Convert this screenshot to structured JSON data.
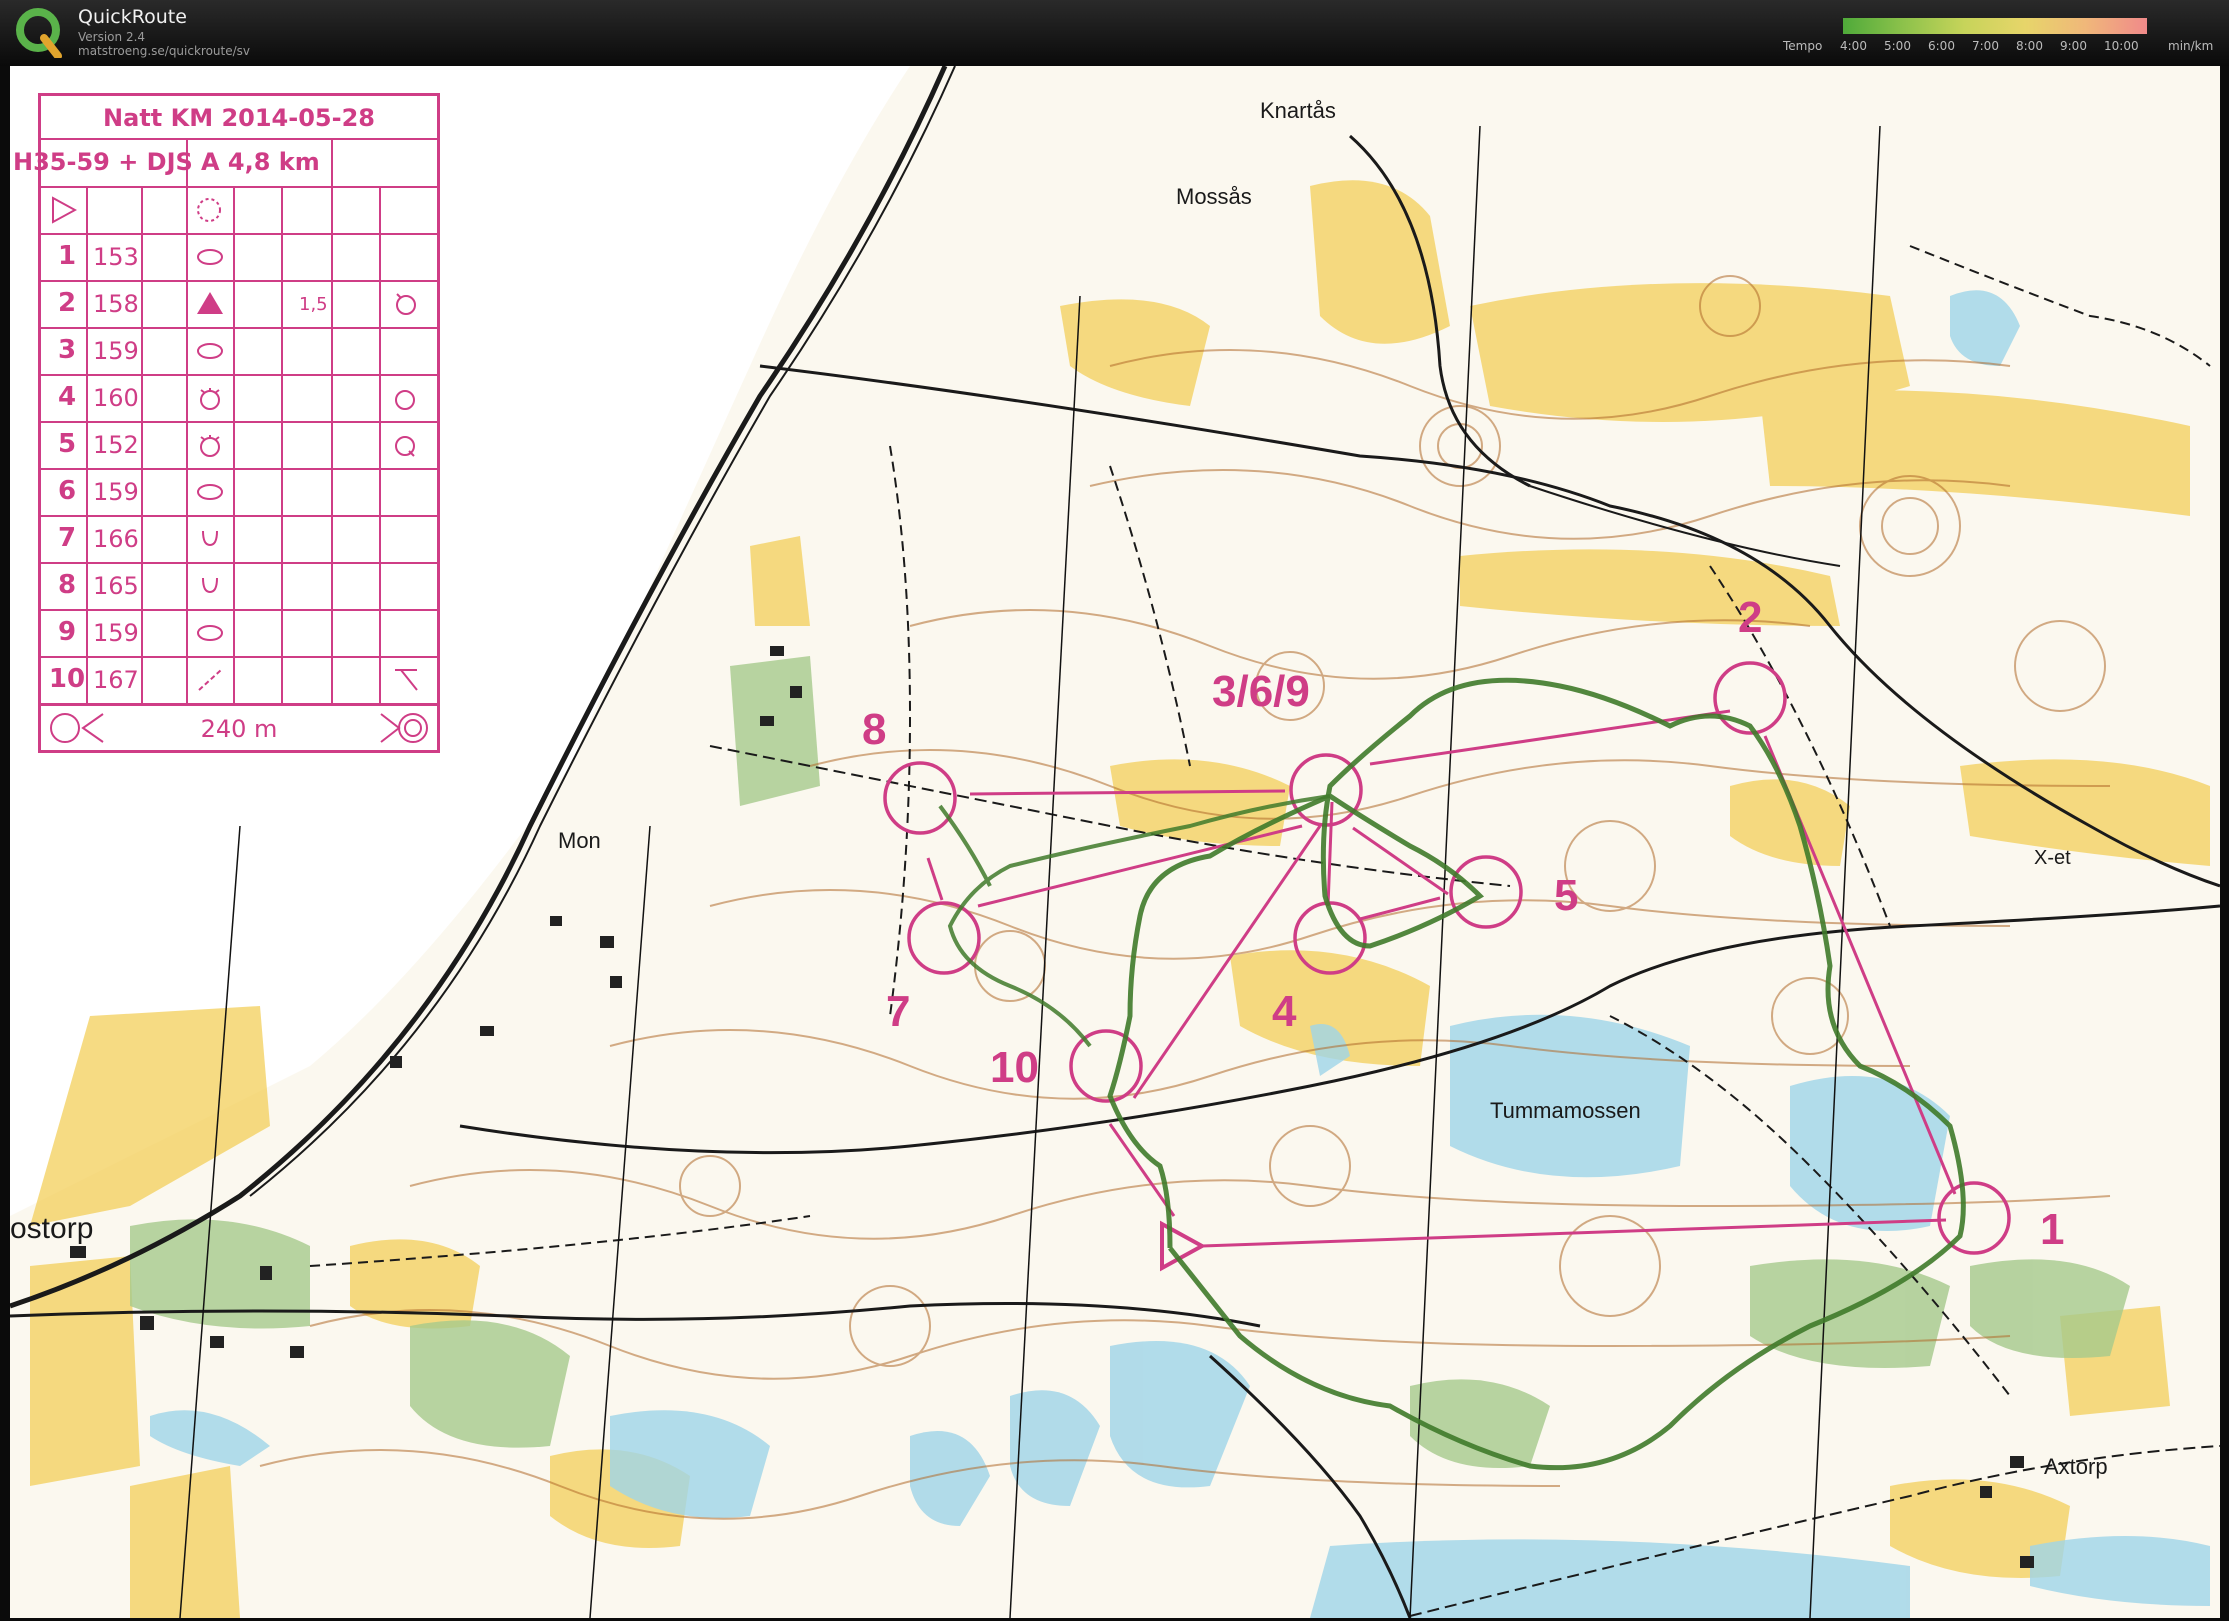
{
  "app": {
    "title": "QuickRoute",
    "version": "Version 2.4",
    "url": "matstroeng.se/quickroute/sv",
    "tempo_label": "Tempo",
    "tempo_ticks": [
      "4:00",
      "5:00",
      "6:00",
      "7:00",
      "8:00",
      "9:00",
      "10:00"
    ],
    "tempo_unit": "min/km"
  },
  "colors": {
    "course": "#cf3d86",
    "route": "#3f7a2a",
    "yellow": "#f3cf5a",
    "water": "#9fd4e8",
    "green": "#a6c98c",
    "contour": "#b06a2a"
  },
  "card": {
    "title": "Natt KM 2014-05-28",
    "class": "H35-59 + DJS",
    "course": "A 4,8 km",
    "controls": [
      {
        "num": "1",
        "code": "153"
      },
      {
        "num": "2",
        "code": "158",
        "dist": "1,5"
      },
      {
        "num": "3",
        "code": "159"
      },
      {
        "num": "4",
        "code": "160"
      },
      {
        "num": "5",
        "code": "152"
      },
      {
        "num": "6",
        "code": "159"
      },
      {
        "num": "7",
        "code": "166"
      },
      {
        "num": "8",
        "code": "165"
      },
      {
        "num": "9",
        "code": "159"
      },
      {
        "num": "10",
        "code": "167"
      }
    ],
    "finish_distance": "240 m"
  },
  "map": {
    "place_names": [
      "Knartås",
      "Mossås",
      "Mon",
      "Tummamossen",
      "Axtorp",
      "X-et",
      "ostorp"
    ],
    "control_labels": [
      "1",
      "2",
      "3/6/9",
      "4",
      "5",
      "7",
      "8",
      "10"
    ]
  }
}
